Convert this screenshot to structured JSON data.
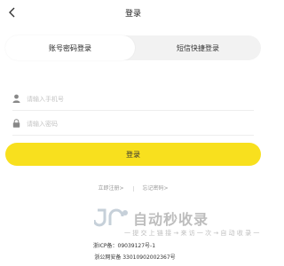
{
  "header": {
    "title": "登录",
    "back_icon": "chevron-left-icon"
  },
  "tabs": [
    {
      "label": "账号密码登录",
      "active": true
    },
    {
      "label": "短信快捷登录",
      "active": false
    }
  ],
  "form": {
    "phone": {
      "placeholder": "请输入手机号",
      "value": "",
      "icon": "user-icon"
    },
    "password": {
      "placeholder": "请输入密码",
      "value": "",
      "icon": "lock-icon"
    },
    "submit_label": "登录",
    "accent_color": "#f8e01e"
  },
  "links": {
    "register": "立即注册>",
    "forgot": "忘记密码>"
  },
  "footer": {
    "icp": "浙ICP备：09039127号-1",
    "police": "浙公网安备 33010902002367号"
  },
  "watermark": {
    "title": "自动秒收录",
    "subtitle": "一 提 交 上 链 接 → 来 访 一 次 → 自 动 收 录 一"
  }
}
